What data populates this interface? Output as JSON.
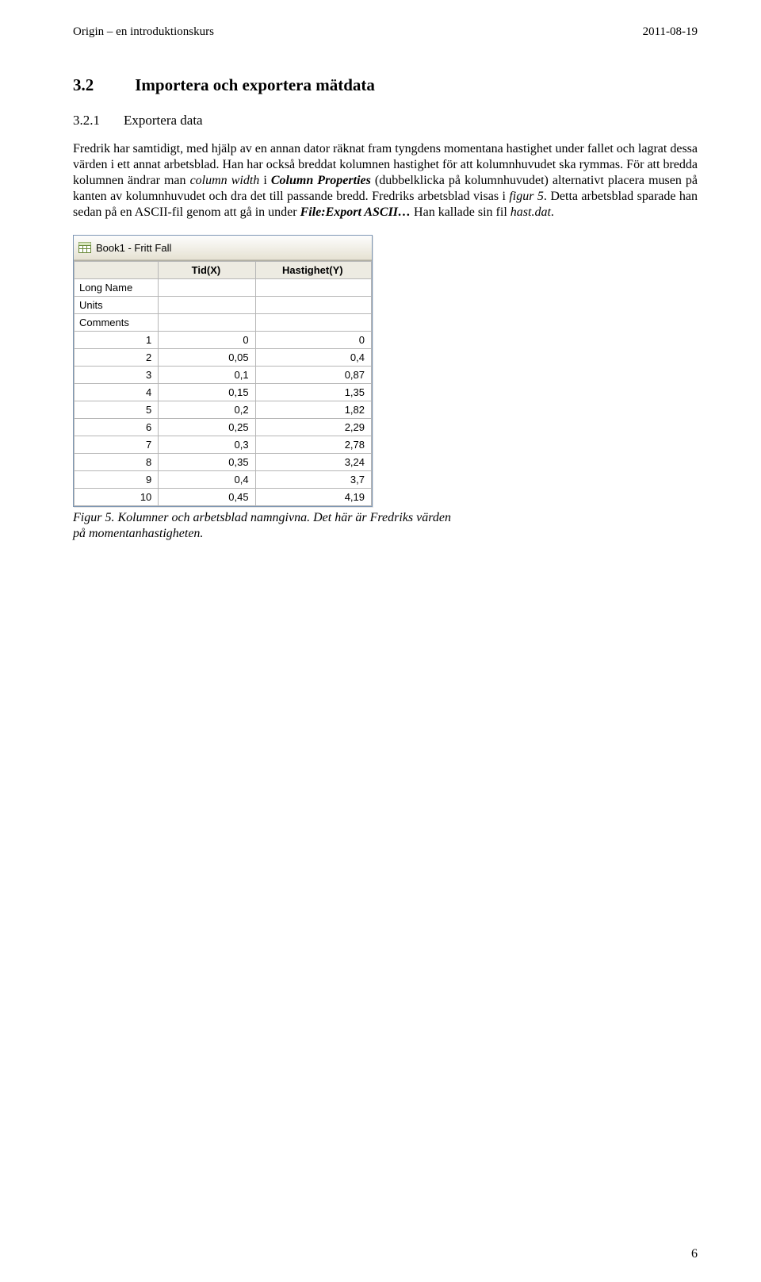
{
  "header": {
    "left": "Origin – en introduktionskurs",
    "right": "2011-08-19"
  },
  "section": {
    "num": "3.2",
    "title": "Importera och exportera mätdata"
  },
  "subsection": {
    "num": "3.2.1",
    "title": "Exportera data"
  },
  "para": {
    "p1a": "Fredrik har samtidigt, med hjälp av en annan dator räknat fram tyngdens momentana hastighet under fallet och lagrat dessa värden i ett annat arbetsblad. Han har också breddat kolumnen hastighet för att kolumnhuvudet ska rymmas. För att bredda kolumnen ändrar man ",
    "p1_i1": "column width",
    "p1b": " i ",
    "p1_bi1": "Column Properties",
    "p1c": " (dubbelklicka på kolumnhuvudet) alternativt placera musen på kanten av kolumnhuvudet och dra det till passande bredd. Fredriks arbetsblad visas i ",
    "p1_i2": "figur 5",
    "p1d": ". Detta arbetsblad sparade han sedan på en ASCII-fil genom att gå in under ",
    "p1_bi2": "File:Export ASCII…",
    "p1e": " Han kallade sin fil ",
    "p1_i3": "hast.dat",
    "p1f": "."
  },
  "origin": {
    "title": "Book1 - Fritt Fall",
    "colA": "Tid(X)",
    "colB": "Hastighet(Y)",
    "rowLabels": {
      "longname": "Long Name",
      "units": "Units",
      "comments": "Comments"
    },
    "rows": [
      {
        "n": "1",
        "x": "0",
        "y": "0"
      },
      {
        "n": "2",
        "x": "0,05",
        "y": "0,4"
      },
      {
        "n": "3",
        "x": "0,1",
        "y": "0,87"
      },
      {
        "n": "4",
        "x": "0,15",
        "y": "1,35"
      },
      {
        "n": "5",
        "x": "0,2",
        "y": "1,82"
      },
      {
        "n": "6",
        "x": "0,25",
        "y": "2,29"
      },
      {
        "n": "7",
        "x": "0,3",
        "y": "2,78"
      },
      {
        "n": "8",
        "x": "0,35",
        "y": "3,24"
      },
      {
        "n": "9",
        "x": "0,4",
        "y": "3,7"
      },
      {
        "n": "10",
        "x": "0,45",
        "y": "4,19"
      }
    ]
  },
  "caption": "Figur 5. Kolumner och arbetsblad namngivna. Det här är Fredriks värden på momentanhastigheten.",
  "pagenum": "6"
}
